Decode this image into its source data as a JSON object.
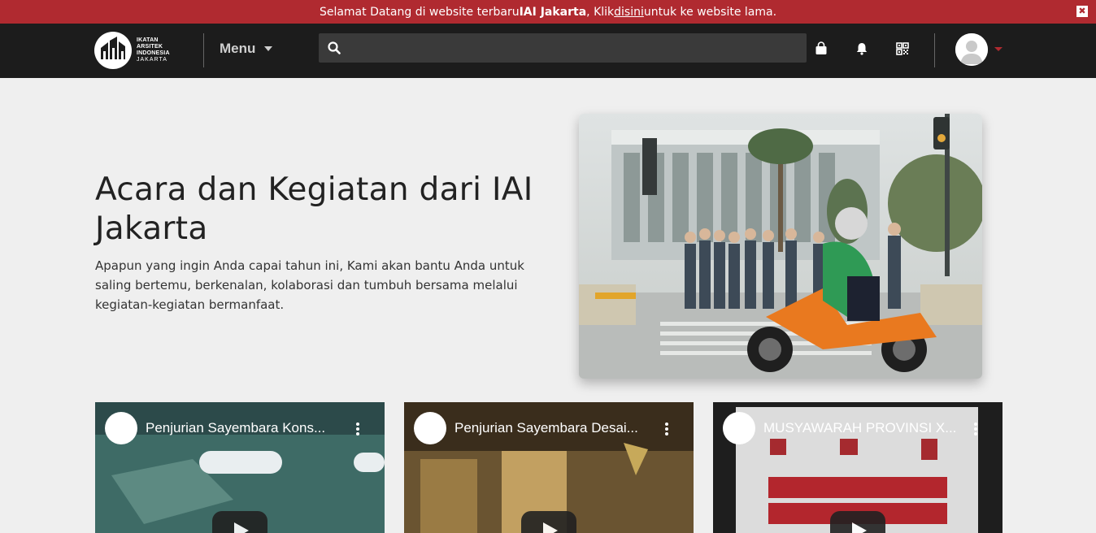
{
  "announcement": {
    "prefix": "Selamat Datang di website terbaru ",
    "brand": "IAI Jakarta",
    "middle": ", Klik ",
    "link": "disini",
    "suffix": " untuk ke website lama.",
    "close_symbol": "✖"
  },
  "logo": {
    "line1": "IKATAN",
    "line2": "ARSITEK",
    "line3": "INDONESIA",
    "line4": "JAKARTA"
  },
  "nav": {
    "menu_label": "Menu",
    "search_placeholder": "",
    "icons": [
      "shopping-bag-icon",
      "bell-icon",
      "qr-code-icon"
    ]
  },
  "hero": {
    "title": "Acara dan Kegiatan dari IAI Jakarta",
    "description": "Apapun yang ingin Anda capai tahun ini, Kami akan bantu Anda untuk saling bertemu, berkenalan, kolaborasi dan tumbuh bersama melalui kegiatan-kegiatan bermanfaat."
  },
  "videos": [
    {
      "title": "Penjurian Sayembara Kons..."
    },
    {
      "title": "Penjurian Sayembara Desai..."
    },
    {
      "title": "MUSYAWARAH PROVINSI X..."
    }
  ],
  "colors": {
    "accent": "#b02a30",
    "navbar": "#1c1c1c",
    "background": "#efefef"
  }
}
